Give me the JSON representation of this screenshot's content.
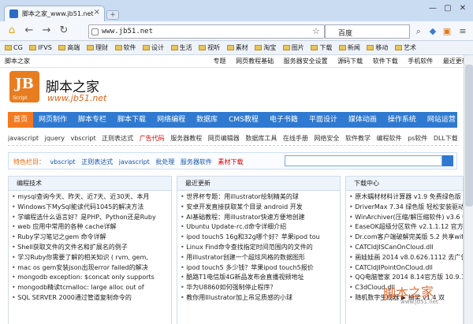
{
  "browser": {
    "tab_title": "脚本之家_www.jb51.net",
    "tab_close": "×",
    "new_tab": "+",
    "window_controls": [
      "—",
      "▢",
      "✕"
    ],
    "url": "www.jb51.net",
    "search_engine": "百度",
    "back": "←",
    "forward": "→",
    "reload": "↻",
    "menu_icon": "≡",
    "star_icon": "☆",
    "bookmarks": [
      "CG",
      "IFVS",
      "高端",
      "理财",
      "软件",
      "设计",
      "生活",
      "视听",
      "素材",
      "淘宝",
      "图片",
      "下载",
      "新闻",
      "移动",
      "艺术"
    ]
  },
  "site": {
    "top_links": [
      "脚本之家",
      "专题",
      "网页教程基础",
      "服务器安全设置",
      "源码下载",
      "软件下载",
      "手机软件",
      "最近更新"
    ],
    "logo_text": "JB",
    "logo_sub": "Script",
    "name": "脚本之家",
    "url": "www.jb51.net",
    "main_nav": [
      "首页",
      "网页制作",
      "脚本专栏",
      "脚本下载",
      "网络编程",
      "数据库",
      "CMS教程",
      "电子书籍",
      "平面设计",
      "媒体动画",
      "操作系统",
      "网站运营"
    ],
    "sub_nav": [
      "javascript",
      "jquery",
      "vbscript",
      "正则表达式",
      "广告代码",
      "服务器教程",
      "网页编辑器",
      "数据库工具",
      "在线手册",
      "网络安全",
      "软件教学",
      "编程软件",
      "ps软件",
      "DLL下载"
    ],
    "feature_label": "特色栏目：",
    "feature_links": [
      "vbscript",
      "正则表达式",
      "javascript",
      "批处理",
      "服务器软件",
      "素材下载"
    ],
    "columns": [
      {
        "title": "编程技术",
        "items": [
          "mysql查询今天、昨天、近7天、近30天、本月",
          "Windows下MySql能读代码1045的解决方法",
          "学编程选什么语言好？是PHP、Python还是Ruby",
          "web 应用中常用的各种 cache详解",
          "Ruby学习笔记之gem 命令详解",
          "Shell获取文件的文件名和扩展名的例子",
          "学习Ruby你需要了解的相关知识 ( rvm, gem,",
          "mac os gem安装json出现error failed的解决",
          "mongodb exception: $concat only supports",
          "mongodb精读tcmalloc: large alloc out of",
          "SQL SERVER 2000通过管道复制命令的"
        ]
      },
      {
        "title": "最近更新",
        "items": [
          "世界杯专题：用illustrator绘制精美的球",
          "安卓开发直接获取某个目录 android 开发",
          "AI基础教程：用illustrator快速方便地创建",
          "Ubuntu Update-rc.d命令详细介绍",
          "ipod touch5 16g和32g哪个好？苹果ipod tou",
          "Linux Find命令查找指定时间范围内的文件的",
          "用illustrator创建一个超炫风格的数据图形",
          "ipod touch5 多少钱？苹果ipod touch5报价",
          "酷路T1电信版4G新品发布会直播视频地址",
          "华为U8860如何强制停止程序？",
          "教你用Illustrator加上吊足质感的小球"
        ]
      },
      {
        "title": "下载中心",
        "items": [
          "原木蠕材材料计算器 v1.9 免费绿色版",
          "DriverMax 7.34 绿色版 轻松安装驱动程序",
          "WinArchiver(压缩/解压缩软件) v3.6 中文",
          "EaseOK超级分区软件 v2.1.1.12 官方安装",
          "Dr.com客户端破解完美版 5.2 共享wifi",
          "CATCldJISCanOnCloud.dll",
          "画娃娃画 2014 v8.0.626.1112 去广告版",
          "CATCldJIPointOnCloud.dll",
          "QQ电脑管家 2014 8.14官方版 10.9.16163.1",
          "C3dCloud.dll",
          "随机数字生成器 ▶ 抽奖 v1.4 双"
        ]
      }
    ],
    "watermark": "脚本之家",
    "watermark_url": "www.jb51.net"
  }
}
